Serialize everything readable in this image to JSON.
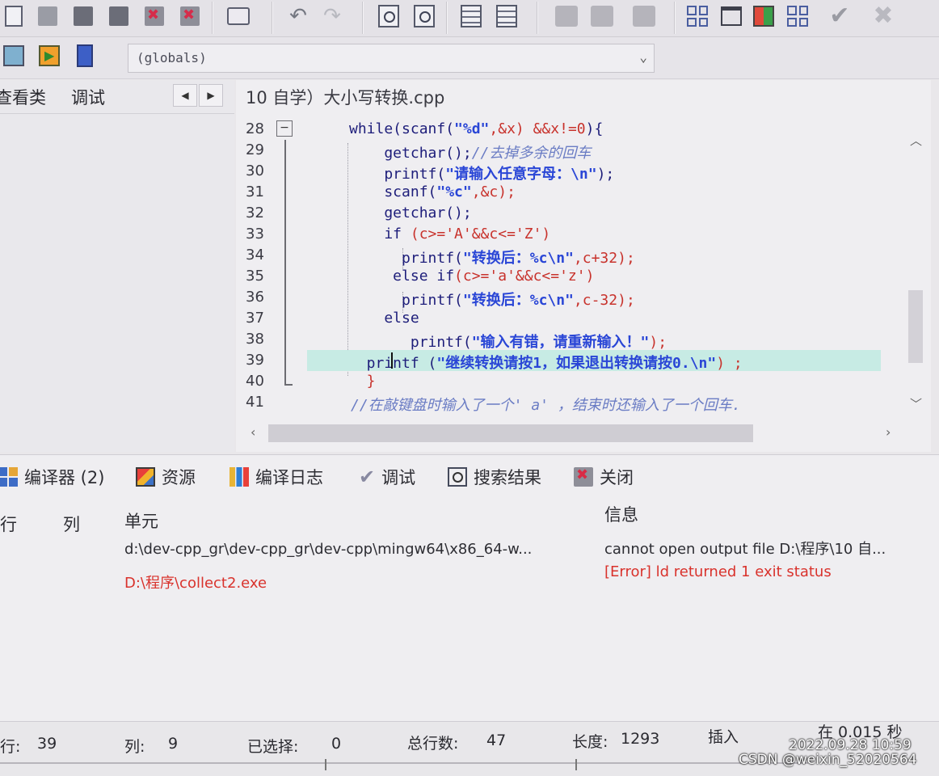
{
  "combo": {
    "value": "(globals)"
  },
  "left_panel": {
    "tabs": [
      "查看类",
      "调试"
    ],
    "prev": "◀",
    "next": "▶"
  },
  "editor": {
    "tab_title": "10 自学）大小写转换.cpp",
    "fold_collapse": "−",
    "lines": [
      {
        "n": "28",
        "segments": [
          {
            "t": "while(scanf(",
            "c": "kw"
          },
          {
            "t": "\"%d\"",
            "c": "str"
          },
          {
            "t": ",&x) ",
            "c": "op"
          },
          {
            "t": "&&x!=0",
            "c": "op"
          },
          {
            "t": "){",
            "c": "kw"
          }
        ]
      },
      {
        "n": "29",
        "segments": [
          {
            "t": "    getchar();",
            "c": "kw"
          },
          {
            "t": "//去掉多余的回车",
            "c": "cm"
          }
        ]
      },
      {
        "n": "30",
        "segments": [
          {
            "t": "    printf(",
            "c": "kw"
          },
          {
            "t": "\"请输入任意字母：\\n\"",
            "c": "str"
          },
          {
            "t": ");",
            "c": "kw"
          }
        ]
      },
      {
        "n": "31",
        "segments": [
          {
            "t": "    scanf(",
            "c": "kw"
          },
          {
            "t": "\"%c\"",
            "c": "str"
          },
          {
            "t": ",&c);",
            "c": "op"
          }
        ]
      },
      {
        "n": "32",
        "segments": [
          {
            "t": "    getchar();",
            "c": "kw"
          }
        ]
      },
      {
        "n": "33",
        "segments": [
          {
            "t": "    if ",
            "c": "kw"
          },
          {
            "t": "(c>='A'&&c<='Z')",
            "c": "op"
          }
        ]
      },
      {
        "n": "34",
        "segments": [
          {
            "t": "      printf(",
            "c": "kw"
          },
          {
            "t": "\"转换后：%c\\n\"",
            "c": "str"
          },
          {
            "t": ",c+32);",
            "c": "op"
          }
        ]
      },
      {
        "n": "35",
        "segments": [
          {
            "t": "     else if",
            "c": "kw"
          },
          {
            "t": "(c>='a'&&c<='z')",
            "c": "op"
          }
        ]
      },
      {
        "n": "36",
        "segments": [
          {
            "t": "      printf(",
            "c": "kw"
          },
          {
            "t": "\"转换后：%c\\n\"",
            "c": "str"
          },
          {
            "t": ",c-32);",
            "c": "op"
          }
        ]
      },
      {
        "n": "37",
        "segments": [
          {
            "t": "    else",
            "c": "kw"
          }
        ]
      },
      {
        "n": "38",
        "segments": [
          {
            "t": "       printf(",
            "c": "kw"
          },
          {
            "t": "\"输入有错，请重新输入！\"",
            "c": "str"
          },
          {
            "t": ");",
            "c": "op"
          }
        ]
      },
      {
        "n": "39",
        "segments": [
          {
            "t": "  printf (",
            "c": "kw"
          },
          {
            "t": "\"继续转换请按1，如果退出转换请按0.\\n\"",
            "c": "str"
          },
          {
            "t": ") ;",
            "c": "op"
          }
        ]
      },
      {
        "n": "40",
        "segments": [
          {
            "t": "  }",
            "c": "op"
          }
        ]
      },
      {
        "n": "41",
        "segments": [
          {
            "t": "//在敲键盘时输入了一个' a' ，结束时还输入了一个回车.",
            "c": "cm"
          }
        ]
      }
    ]
  },
  "bottom_tabs": [
    {
      "label": "编译器 (2)",
      "icon": "compiler-icon"
    },
    {
      "label": "资源",
      "icon": "resources-icon"
    },
    {
      "label": "编译日志",
      "icon": "compile-log-icon"
    },
    {
      "label": "调试",
      "icon": "debug-check-icon"
    },
    {
      "label": "搜索结果",
      "icon": "search-results-icon"
    },
    {
      "label": "关闭",
      "icon": "close-icon"
    }
  ],
  "messages": {
    "columns": {
      "row": "行",
      "col": "列",
      "unit": "单元",
      "info": "信息"
    },
    "rows": [
      {
        "unit": "d:\\dev-cpp_gr\\dev-cpp_gr\\dev-cpp\\mingw64\\x86_64-w...",
        "info": "cannot open output file D:\\程序\\10 自...",
        "kind": "norm"
      },
      {
        "unit": "D:\\程序\\collect2.exe",
        "info": "[Error] ld returned 1 exit status",
        "kind": "err"
      }
    ]
  },
  "status_bar": {
    "row_label": "行:",
    "row_value": "39",
    "col_label": "列:",
    "col_value": "9",
    "sel_label": "已选择:",
    "sel_value": "0",
    "total_label": "总行数:",
    "total_value": "47",
    "len_label": "长度:",
    "len_value": "1293",
    "mode": "插入",
    "time": "在 0.015 秒"
  },
  "photo_overlay": {
    "timestamp": "2022.09.28  10:59",
    "watermark": "CSDN @weixin_52020564"
  },
  "colors": {
    "highlight": "#c7ebe4",
    "error": "#d9322c",
    "keyword": "#1d1d7a",
    "string": "#2a46d6"
  }
}
